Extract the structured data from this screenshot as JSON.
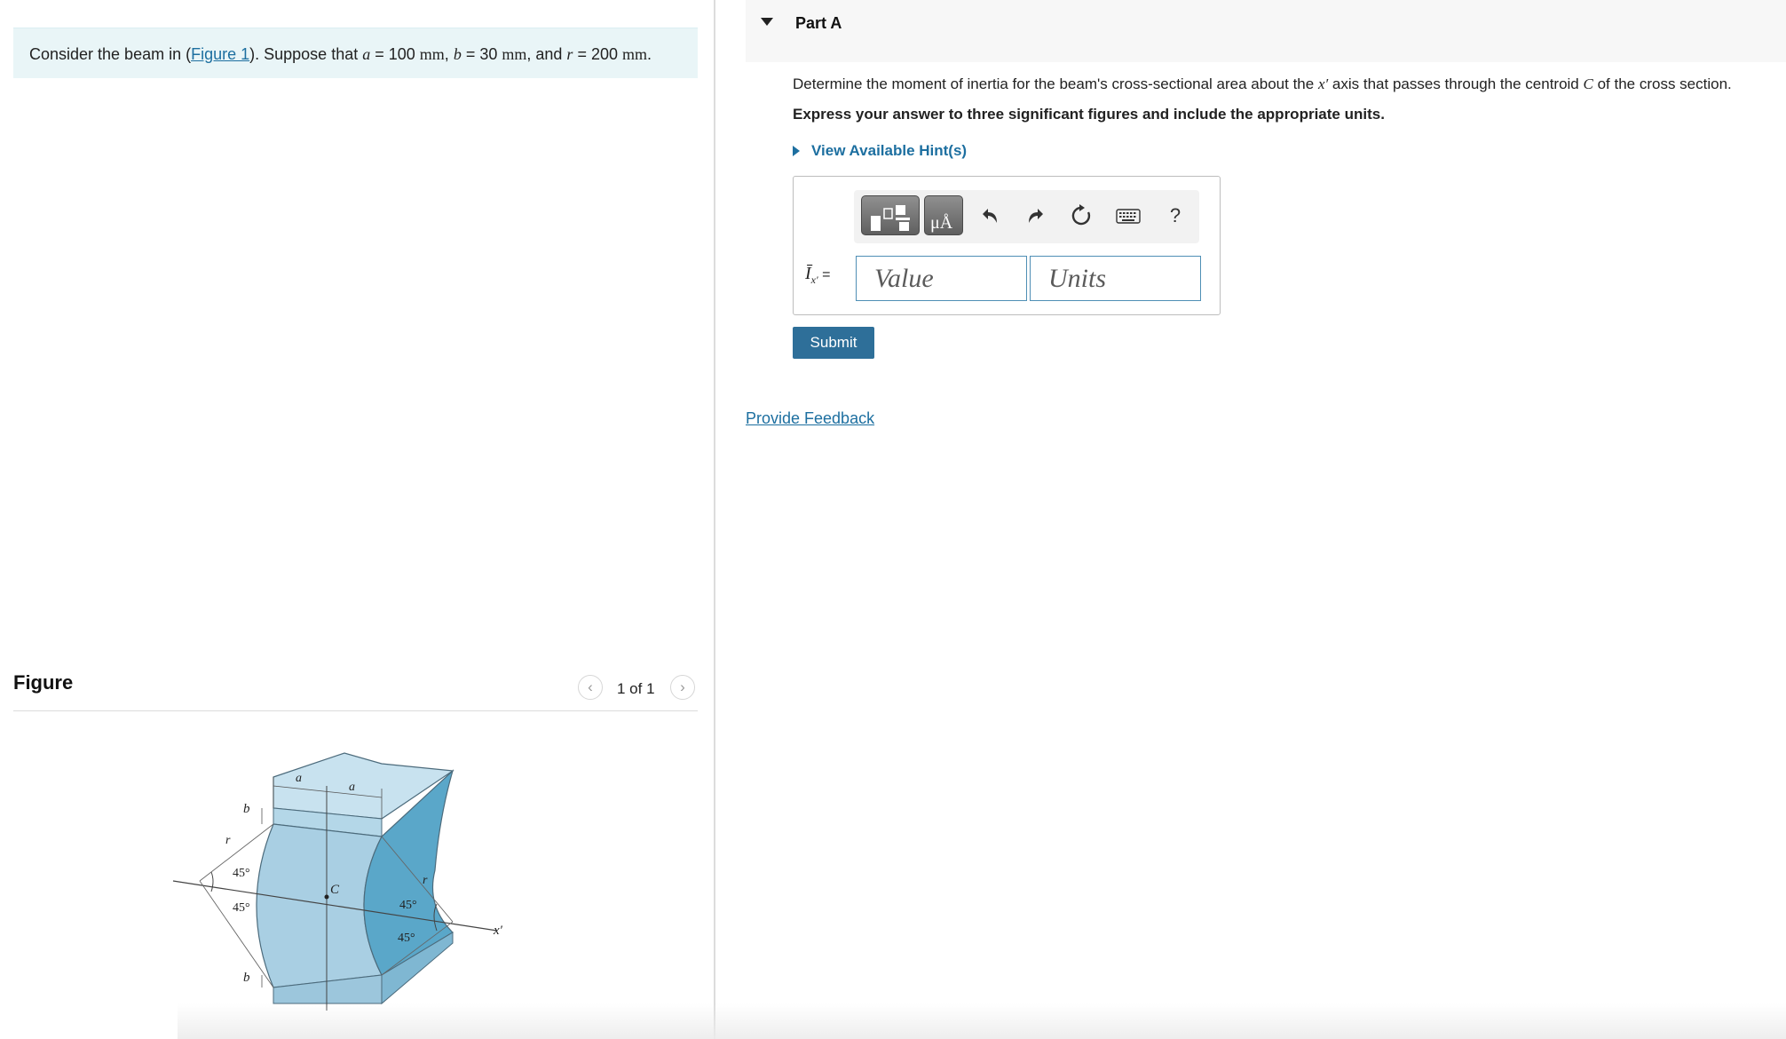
{
  "problem": {
    "before": "Consider the beam in (",
    "figure_link": "Figure 1",
    "after": "). Suppose that ",
    "a_var": "a",
    "a_val": " = 100 ",
    "a_unit": "mm",
    "sep1": ", ",
    "b_var": "b",
    "b_val": " = 30 ",
    "b_unit": "mm",
    "sep2": ", and ",
    "r_var": "r",
    "r_val": " = 200 ",
    "r_unit": "mm",
    "end": "."
  },
  "figure": {
    "title": "Figure",
    "counter": "1 of 1",
    "prev_icon": "chevron-left-icon",
    "next_icon": "chevron-right-icon",
    "labels": {
      "a": "a",
      "b": "b",
      "r": "r",
      "angle": "45°",
      "centroid": "C",
      "axis": "x′"
    },
    "colors": {
      "beam": "#a9cfe3",
      "beam_dark": "#5aa7c9",
      "beam_top": "#c8e2ef"
    }
  },
  "part": {
    "title": "Part A",
    "question_before": "Determine the moment of inertia for the beam's cross-sectional area about the ",
    "question_axis": "x′",
    "question_middle": " axis that passes through the centroid ",
    "question_c": "C",
    "question_end": " of the cross section.",
    "instruction": "Express your answer to three significant figures and include the appropriate units.",
    "hints": "View Available Hint(s)"
  },
  "toolbar": {
    "templates_icon": "templates-icon",
    "units_icon": "units-icon",
    "units_glyph": "μÅ",
    "undo_icon": "undo-icon",
    "redo_icon": "redo-icon",
    "reset_icon": "reset-icon",
    "keyboard_icon": "keyboard-icon",
    "help_label": "?"
  },
  "answer": {
    "label_symbol": "Ī",
    "label_sub": "x′",
    "label_eq": " =",
    "value_placeholder": "Value",
    "units_placeholder": "Units",
    "submit_label": "Submit"
  },
  "feedback": {
    "label": "Provide Feedback"
  }
}
